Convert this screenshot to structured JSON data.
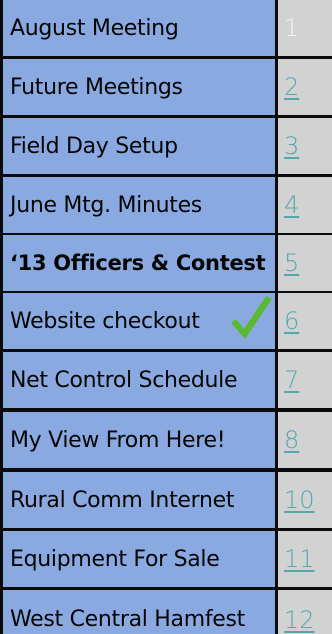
{
  "toc": {
    "rows": [
      {
        "title": "August Meeting",
        "page": "1",
        "current": true
      },
      {
        "title": "Future Meetings",
        "page": "2"
      },
      {
        "title": "Field Day Setup",
        "page": "3"
      },
      {
        "title": "June Mtg. Minutes",
        "page": "4"
      },
      {
        "title": "‘13 Officers & Contest",
        "page": "5",
        "bold": true
      },
      {
        "title": "Website checkout",
        "page": "6",
        "checked": true
      },
      {
        "title": "Net Control Schedule",
        "page": "7"
      },
      {
        "title": "My View From Here!",
        "page": "8"
      },
      {
        "title": "Rural Comm Internet",
        "page": "10"
      },
      {
        "title": "Equipment For Sale",
        "page": "11"
      },
      {
        "title": "West Central Hamfest",
        "page": "12"
      }
    ]
  },
  "colors": {
    "title_bg": "#8aa9e0",
    "page_bg": "#d2d2d2",
    "link": "#52a8ac",
    "checkmark": "#5bb832"
  },
  "icons": {
    "checkmark": "checkmark-icon"
  }
}
